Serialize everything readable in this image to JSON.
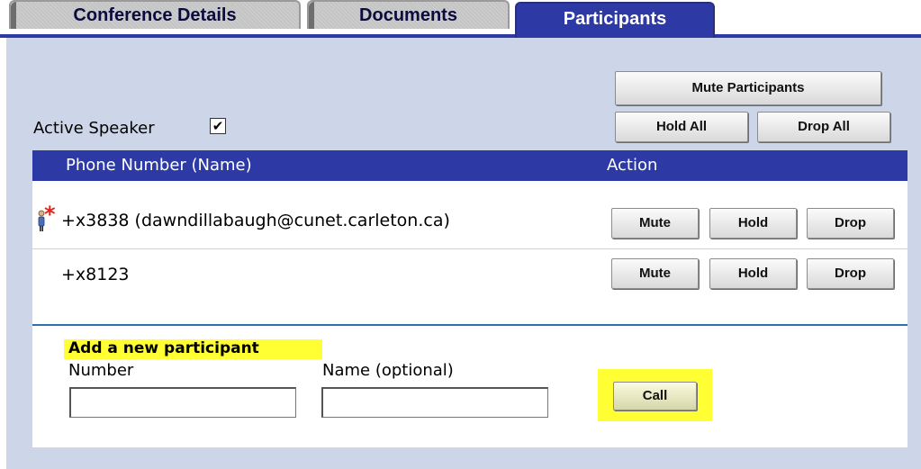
{
  "tabs": [
    {
      "label": "Conference Details"
    },
    {
      "label": "Documents"
    },
    {
      "label": "Participants"
    }
  ],
  "buttons": {
    "mute_participants": "Mute Participants",
    "hold_all": "Hold All",
    "drop_all": "Drop All"
  },
  "active_speaker": {
    "label": "Active Speaker",
    "checked": true
  },
  "table": {
    "headers": [
      "Phone Number (Name)",
      "Action"
    ],
    "rows": [
      {
        "number": "+x3838 (dawndillabaugh@cunet.carleton.ca)",
        "active_speaker": true,
        "actions": [
          "Mute",
          "Hold",
          "Drop"
        ]
      },
      {
        "number": "+x8123",
        "active_speaker": false,
        "actions": [
          "Mute",
          "Hold",
          "Drop"
        ]
      }
    ]
  },
  "add_participant": {
    "title": "Add a new participant",
    "number_label": "Number",
    "number_value": "",
    "name_label": "Name (optional)",
    "name_value": "",
    "call_label": "Call"
  },
  "colors": {
    "tab_active": "#2d3aa6",
    "panel_bg": "#cdd6e8",
    "highlight": "#ffff33",
    "speaker_star": "#e2231a"
  },
  "icons": [
    "person-icon",
    "red-asterisk-icon",
    "checkbox-checked-icon"
  ]
}
